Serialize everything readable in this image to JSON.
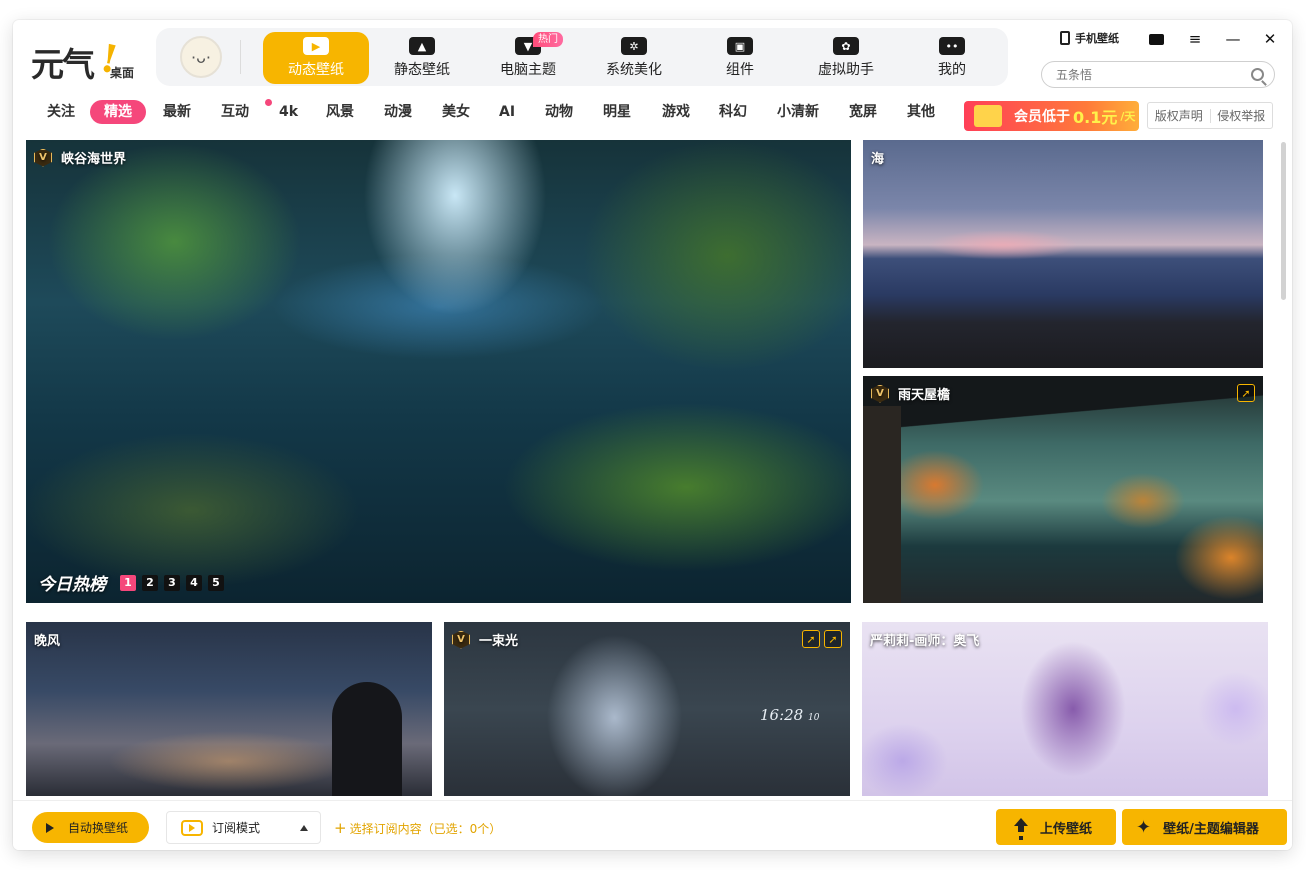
{
  "app": {
    "logo_text": "元气",
    "logo_bang": "!",
    "logo_sub": "桌面"
  },
  "mascot": {
    "face": "·ᴗ·"
  },
  "nav": {
    "items": [
      {
        "label": "动态壁纸",
        "icon": "video-play-icon",
        "active": true
      },
      {
        "label": "静态壁纸",
        "icon": "image-icon"
      },
      {
        "label": "电脑主题",
        "icon": "tshirt-icon"
      },
      {
        "label": "系统美化",
        "icon": "flower-icon"
      },
      {
        "label": "组件",
        "icon": "widget-icon"
      },
      {
        "label": "虚拟助手",
        "icon": "paw-icon"
      },
      {
        "label": "我的",
        "icon": "face-icon"
      }
    ],
    "hot_badge": "热门"
  },
  "window_controls": {
    "mobile_label": "手机壁纸",
    "mail": "mail-icon",
    "menu": "≡",
    "minimize": "—",
    "close": "✕"
  },
  "search": {
    "placeholder": "五条悟",
    "value": ""
  },
  "categories": {
    "items": [
      "关注",
      "精选",
      "最新",
      "互动",
      "4k",
      "风景",
      "动漫",
      "美女",
      "AI",
      "动物",
      "明星",
      "游戏",
      "科幻",
      "小清新",
      "宽屏",
      "其他"
    ],
    "active_index": 1
  },
  "vip_banner": {
    "prefix": "会员低于",
    "price": "0.1元",
    "suffix": "/天"
  },
  "legal": {
    "copyright": "版权声明",
    "report": "侵权举报"
  },
  "tiles": {
    "featured": {
      "title": "峡谷海世界",
      "vip": "V",
      "hot_label": "今日热榜",
      "pages": [
        "1",
        "2",
        "3",
        "4",
        "5"
      ],
      "active_page": 0
    },
    "sea": {
      "title": "海"
    },
    "rain": {
      "title": "雨天屋檐",
      "vip": "V"
    },
    "evening": {
      "title": "晚风"
    },
    "light": {
      "title": "一束光",
      "vip": "V",
      "clock": "16:28",
      "clock_sec": "10"
    },
    "anime": {
      "title": "严莉莉-画师：奥飞"
    }
  },
  "bottom": {
    "auto_label": "自动换壁纸",
    "mode_label": "订阅模式",
    "subscribe_plus": "+",
    "subscribe_label": "选择订阅内容（已选：0个）",
    "upload_label": "上传壁纸",
    "editor_label": "壁纸/主题编辑器"
  },
  "colors": {
    "accent": "#f7b500",
    "pink": "#f5477b",
    "vip_gold": "#e7b85a"
  }
}
